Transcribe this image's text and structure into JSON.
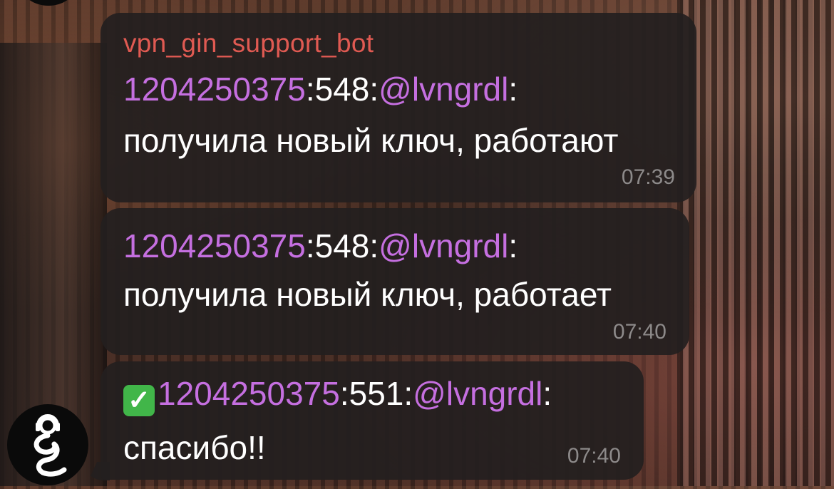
{
  "chat": {
    "messages": [
      {
        "sender": "vpn_gin_support_bot",
        "id": "1204250375",
        "sep1": ":",
        "num": "548",
        "sep2": ":",
        "handle": "@lvngrdl",
        "sep3": ":",
        "text": "получила новый ключ, работают",
        "time": "07:39"
      },
      {
        "id": "1204250375",
        "sep1": ":",
        "num": "548",
        "sep2": ":",
        "handle": "@lvngrdl",
        "sep3": ":",
        "text": "получила новый ключ, работает",
        "time": "07:40"
      },
      {
        "status_icon": "check-mark-button-icon",
        "status_glyph": "✓",
        "id": "1204250375",
        "sep1": ":",
        "num": "551",
        "sep2": ":",
        "handle": "@lvngrdl",
        "sep3": ":",
        "text": "спасибо!!",
        "time": "07:40"
      }
    ]
  },
  "colors": {
    "sender": "#e05a52",
    "mention": "#c56fe0",
    "bubble": "#241f1f",
    "time": "#8d8a8a",
    "check": "#41b649"
  },
  "avatar": {
    "icon": "support-headset-avatar-icon"
  }
}
